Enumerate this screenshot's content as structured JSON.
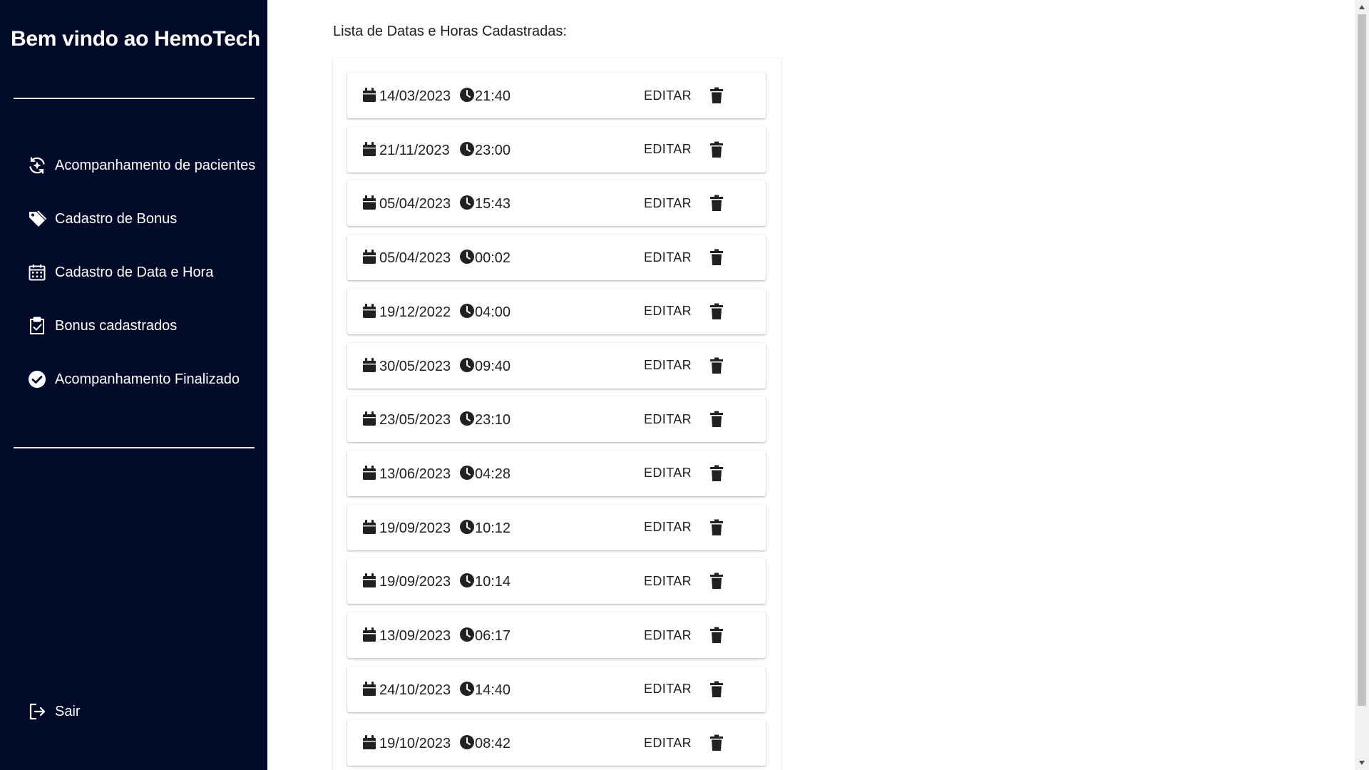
{
  "sidebar": {
    "title": "Bem vindo ao HemoTech",
    "items": [
      {
        "label": "Acompanhamento de pacientes",
        "icon": "sparkle-refresh-icon"
      },
      {
        "label": "Cadastro de Bonus",
        "icon": "tag-icon"
      },
      {
        "label": "Cadastro de Data e Hora",
        "icon": "calendar-icon"
      },
      {
        "label": "Bonus cadastrados",
        "icon": "clipboard-check-icon"
      },
      {
        "label": "Acompanhamento Finalizado",
        "icon": "check-circle-icon"
      }
    ],
    "logout_label": "Sair"
  },
  "main": {
    "list_title": "Lista de Datas e Horas Cadastradas:",
    "edit_label": "EDITAR",
    "entries": [
      {
        "date": "14/03/2023",
        "time": "21:40"
      },
      {
        "date": "21/11/2023",
        "time": "23:00"
      },
      {
        "date": "05/04/2023",
        "time": "15:43"
      },
      {
        "date": "05/04/2023",
        "time": "00:02"
      },
      {
        "date": "19/12/2022",
        "time": "04:00"
      },
      {
        "date": "30/05/2023",
        "time": "09:40"
      },
      {
        "date": "23/05/2023",
        "time": "23:10"
      },
      {
        "date": "13/06/2023",
        "time": "04:28"
      },
      {
        "date": "19/09/2023",
        "time": "10:12"
      },
      {
        "date": "19/09/2023",
        "time": "10:14"
      },
      {
        "date": "13/09/2023",
        "time": "06:17"
      },
      {
        "date": "24/10/2023",
        "time": "14:40"
      },
      {
        "date": "19/10/2023",
        "time": "08:42"
      }
    ]
  },
  "colors": {
    "sidebar_bg": "#020a2a",
    "sidebar_text": "#ffffff",
    "text": "#212121"
  }
}
